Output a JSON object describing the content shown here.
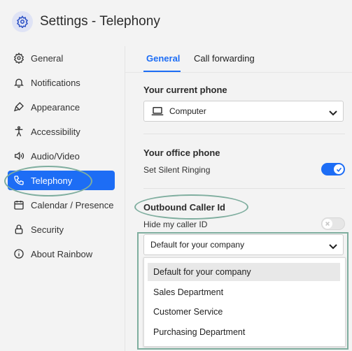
{
  "header": {
    "title": "Settings - Telephony",
    "icon": "gear-icon"
  },
  "sidebar": {
    "items": [
      {
        "label": "General",
        "icon": "gear-icon"
      },
      {
        "label": "Notifications",
        "icon": "bell-icon"
      },
      {
        "label": "Appearance",
        "icon": "paint-brush-icon"
      },
      {
        "label": "Accessibility",
        "icon": "accessibility-icon"
      },
      {
        "label": "Audio/Video",
        "icon": "speaker-icon"
      },
      {
        "label": "Telephony",
        "icon": "phone-icon",
        "active": true
      },
      {
        "label": "Calendar / Presence",
        "icon": "calendar-icon"
      },
      {
        "label": "Security",
        "icon": "lock-icon"
      },
      {
        "label": "About Rainbow",
        "icon": "info-icon"
      }
    ]
  },
  "tabs": [
    {
      "label": "General",
      "active": true
    },
    {
      "label": "Call forwarding",
      "active": false
    }
  ],
  "current_phone": {
    "title": "Your current phone",
    "value": "Computer",
    "icon": "laptop-icon"
  },
  "office_phone": {
    "title": "Your office phone",
    "silent_ringing_label": "Set Silent Ringing",
    "silent_ringing_on": true
  },
  "caller_id": {
    "title": "Outbound Caller Id",
    "hide_label": "Hide my caller ID",
    "hide_on": false,
    "selected": "Default for your company",
    "options": [
      "Default for your company",
      "Sales Department",
      "Customer Service",
      "Purchasing Department"
    ]
  },
  "colors": {
    "accent": "#1d6df5",
    "annotation": "#7fae9f",
    "background": "#f3f3f3"
  }
}
